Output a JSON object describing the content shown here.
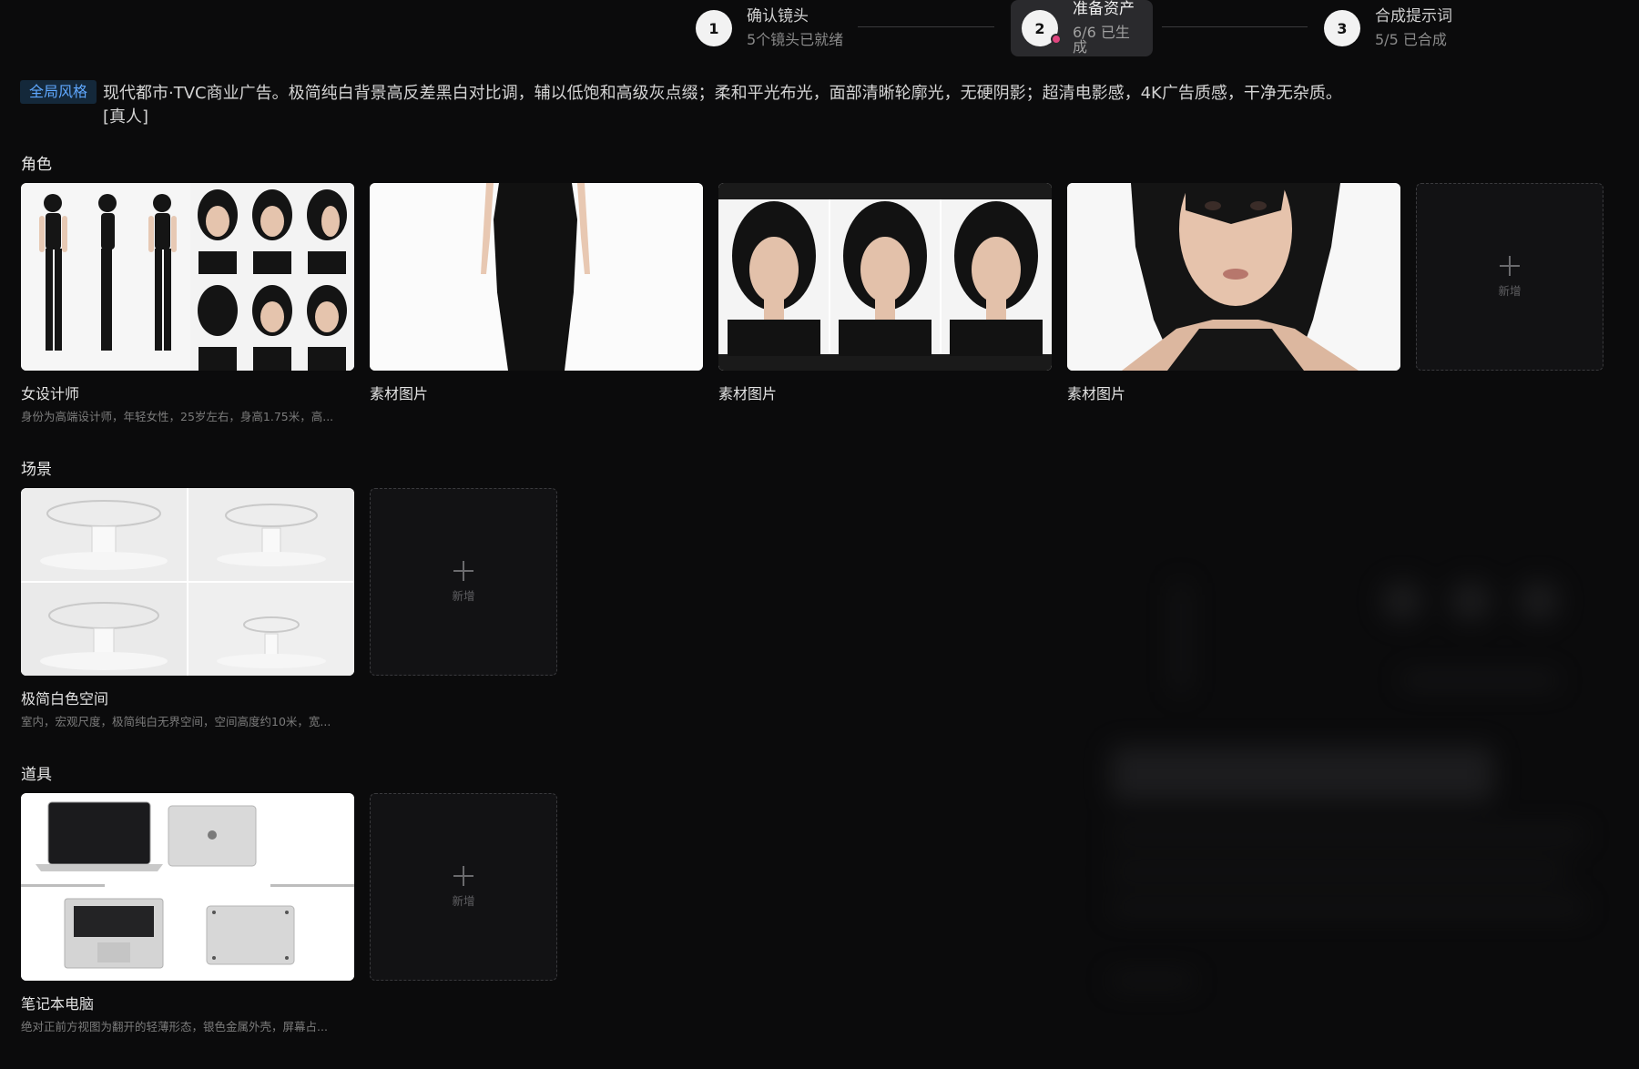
{
  "stepper": {
    "steps": [
      {
        "number": "1",
        "title": "确认镜头",
        "subtitle": "5个镜头已就绪"
      },
      {
        "number": "2",
        "title": "准备资产",
        "subtitle": "6/6 已生成"
      },
      {
        "number": "3",
        "title": "合成提示词",
        "subtitle": "5/5 已合成"
      }
    ]
  },
  "global_style": {
    "tag": "全局风格",
    "text": "现代都市·TVC商业广告。极简纯白背景高反差黑白对比调，辅以低饱和高级灰点缀；柔和平光布光，面部清晰轮廓光，无硬阴影；超清电影感，4K广告质感，干净无杂质。\n[真人]"
  },
  "sections": {
    "characters": {
      "label": "角色",
      "cards": [
        {
          "title": "女设计师",
          "desc": "身份为高端设计师，年轻女性，25岁左右，身高1.75米，高...",
          "image": "character-turnaround-sheet"
        },
        {
          "title": "素材图片",
          "desc": "",
          "image": "black-dress-photo"
        },
        {
          "title": "素材图片",
          "desc": "",
          "image": "expression-portrait-grid"
        },
        {
          "title": "素材图片",
          "desc": "",
          "image": "closeup-portrait"
        }
      ],
      "add_label": "新增"
    },
    "scenes": {
      "label": "场景",
      "cards": [
        {
          "title": "极简白色空间",
          "desc": "室内，宏观尺度，极简纯白无界空间，空间高度约10米，宽...",
          "image": "white-space-grid"
        }
      ],
      "add_label": "新增"
    },
    "props": {
      "label": "道具",
      "cards": [
        {
          "title": "笔记本电脑",
          "desc": "绝对正前方视图为翻开的轻薄形态，银色金属外壳，屏幕占...",
          "image": "laptop-views"
        }
      ],
      "add_label": "新增"
    }
  },
  "colors": {
    "background": "#0b0b0c",
    "accent_tag_text": "#5fa8ff",
    "active_step_dot": "#e0457f"
  }
}
